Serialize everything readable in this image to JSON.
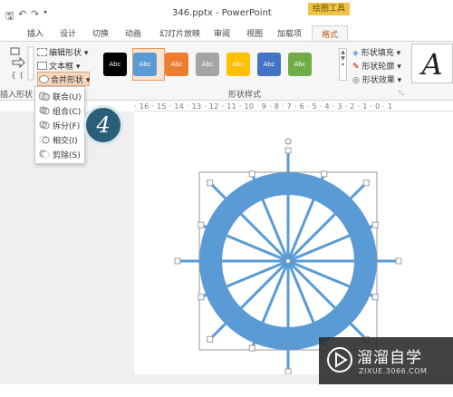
{
  "titlebar": {
    "quick_access": [
      "🖫",
      "↶",
      "↷",
      "▾"
    ],
    "document_title": "346.pptx - PowerPoint",
    "contextual_group": "绘图工具"
  },
  "tabs": [
    "插入",
    "设计",
    "切换",
    "动画",
    "幻灯片放映",
    "审阅",
    "视图",
    "加载项",
    "格式"
  ],
  "active_tab": "格式",
  "ribbon": {
    "insert_shapes": {
      "edit_shape": "编辑形状",
      "text_box": "文本框",
      "merge_shapes": "合并形状",
      "group_label": "插入形状"
    },
    "shape_styles": {
      "style_text": "Abc",
      "styles": [
        {
          "color": "#000000"
        },
        {
          "color": "#5b9bd5"
        },
        {
          "color": "#ed7d31"
        },
        {
          "color": "#a5a5a5"
        },
        {
          "color": "#ffc000"
        },
        {
          "color": "#4472c4"
        },
        {
          "color": "#70ad47"
        }
      ],
      "selected_index": 1,
      "fill": "形状填充",
      "outline": "形状轮廓",
      "effects": "形状效果",
      "group_label": "形状样式"
    },
    "wordart_letter": "A"
  },
  "merge_menu": {
    "items": [
      {
        "label": "联合(U)",
        "icon": "union-icon"
      },
      {
        "label": "组合(C)",
        "icon": "combine-icon"
      },
      {
        "label": "拆分(F)",
        "icon": "fragment-icon"
      },
      {
        "label": "相交(I)",
        "icon": "intersect-icon"
      },
      {
        "label": "剪除(S)",
        "icon": "subtract-icon"
      }
    ]
  },
  "ruler": {
    "ticks": "· 16 · 15 · 14 · 13 · 12 · 11 · 10 · 9 · 8 · 7 · 6 · 5 · 4 · 3 · 2 · 1 · 0 · 1"
  },
  "step_badge": "4",
  "canvas": {
    "ring_color": "#5b9bd5",
    "spoke_count": 16
  },
  "watermark": {
    "title": "溜溜自学",
    "url": "ZIXUE.3066.COM"
  }
}
